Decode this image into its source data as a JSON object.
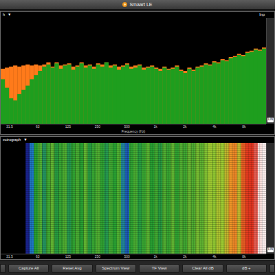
{
  "window": {
    "title": "Smaart LE"
  },
  "spectrum": {
    "label": "h",
    "menu": "▼",
    "right_label": "Inp",
    "tag": "LIN",
    "axis": {
      "title": "Frequency (Hz)",
      "ticks": [
        "31.5",
        "63",
        "125",
        "250",
        "500",
        "1k",
        "2k",
        "4k",
        "8k"
      ]
    },
    "series": [
      {
        "name": "average",
        "color": "#ff7a1a",
        "values": [
          -48,
          -47,
          -46,
          -45,
          -46,
          -45,
          -44,
          -45,
          -44,
          -45,
          -44,
          -42,
          -46,
          -42,
          -45,
          -44,
          -43,
          -46,
          -45,
          -42,
          -45,
          -44,
          -46,
          -43,
          -44,
          -42,
          -45,
          -44,
          -46,
          -45,
          -43,
          -46,
          -45,
          -44,
          -47,
          -46,
          -45,
          -47,
          -48,
          -46,
          -48,
          -47,
          -45,
          -49,
          -50,
          -47,
          -49,
          -46,
          -45,
          -43,
          -44,
          -41,
          -42,
          -39,
          -40,
          -37,
          -36,
          -34,
          -35,
          -32,
          -31,
          -29,
          -30,
          -28
        ]
      },
      {
        "name": "live",
        "color": "#1e9e1e",
        "values": [
          -58,
          -66,
          -76,
          -78,
          -72,
          -68,
          -64,
          -58,
          -54,
          -50,
          -46,
          -44,
          -47,
          -43,
          -48,
          -45,
          -44,
          -49,
          -46,
          -43,
          -47,
          -45,
          -48,
          -44,
          -46,
          -42,
          -47,
          -45,
          -49,
          -46,
          -44,
          -48,
          -47,
          -45,
          -49,
          -47,
          -46,
          -48,
          -50,
          -47,
          -49,
          -48,
          -46,
          -50,
          -52,
          -48,
          -50,
          -47,
          -46,
          -44,
          -45,
          -42,
          -43,
          -40,
          -41,
          -38,
          -37,
          -35,
          -36,
          -33,
          -32,
          -30,
          -31,
          -29
        ]
      }
    ]
  },
  "spectrograph": {
    "label": "ectrograph",
    "menu": "▼",
    "tag": "LIN",
    "axis": {
      "ticks": [
        "31.5",
        "63",
        "125",
        "250",
        "500",
        "1k",
        "2k",
        "4k",
        "8k"
      ]
    },
    "levels": [
      0,
      0,
      0,
      0,
      0,
      0,
      0.2,
      0.35,
      0.45,
      0.5,
      0.42,
      0.48,
      0.52,
      0.44,
      0.47,
      0.5,
      0.43,
      0.46,
      0.49,
      0.45,
      0.52,
      0.44,
      0.47,
      0.5,
      0.46,
      0.43,
      0.48,
      0.45,
      0.5,
      0.38,
      0.3,
      0.46,
      0.49,
      0.44,
      0.47,
      0.51,
      0.45,
      0.48,
      0.44,
      0.5,
      0.47,
      0.52,
      0.46,
      0.5,
      0.48,
      0.53,
      0.5,
      0.55,
      0.52,
      0.56,
      0.6,
      0.58,
      0.62,
      0.6,
      0.65,
      0.72,
      0.74,
      0.65,
      0.8,
      0.85,
      0.86,
      0.9,
      0.98,
      0.99
    ]
  },
  "buttons": [
    "Capture All",
    "Reset Avg",
    "Spectrum View",
    "TF View",
    "Clear All dB",
    "dB +"
  ]
}
